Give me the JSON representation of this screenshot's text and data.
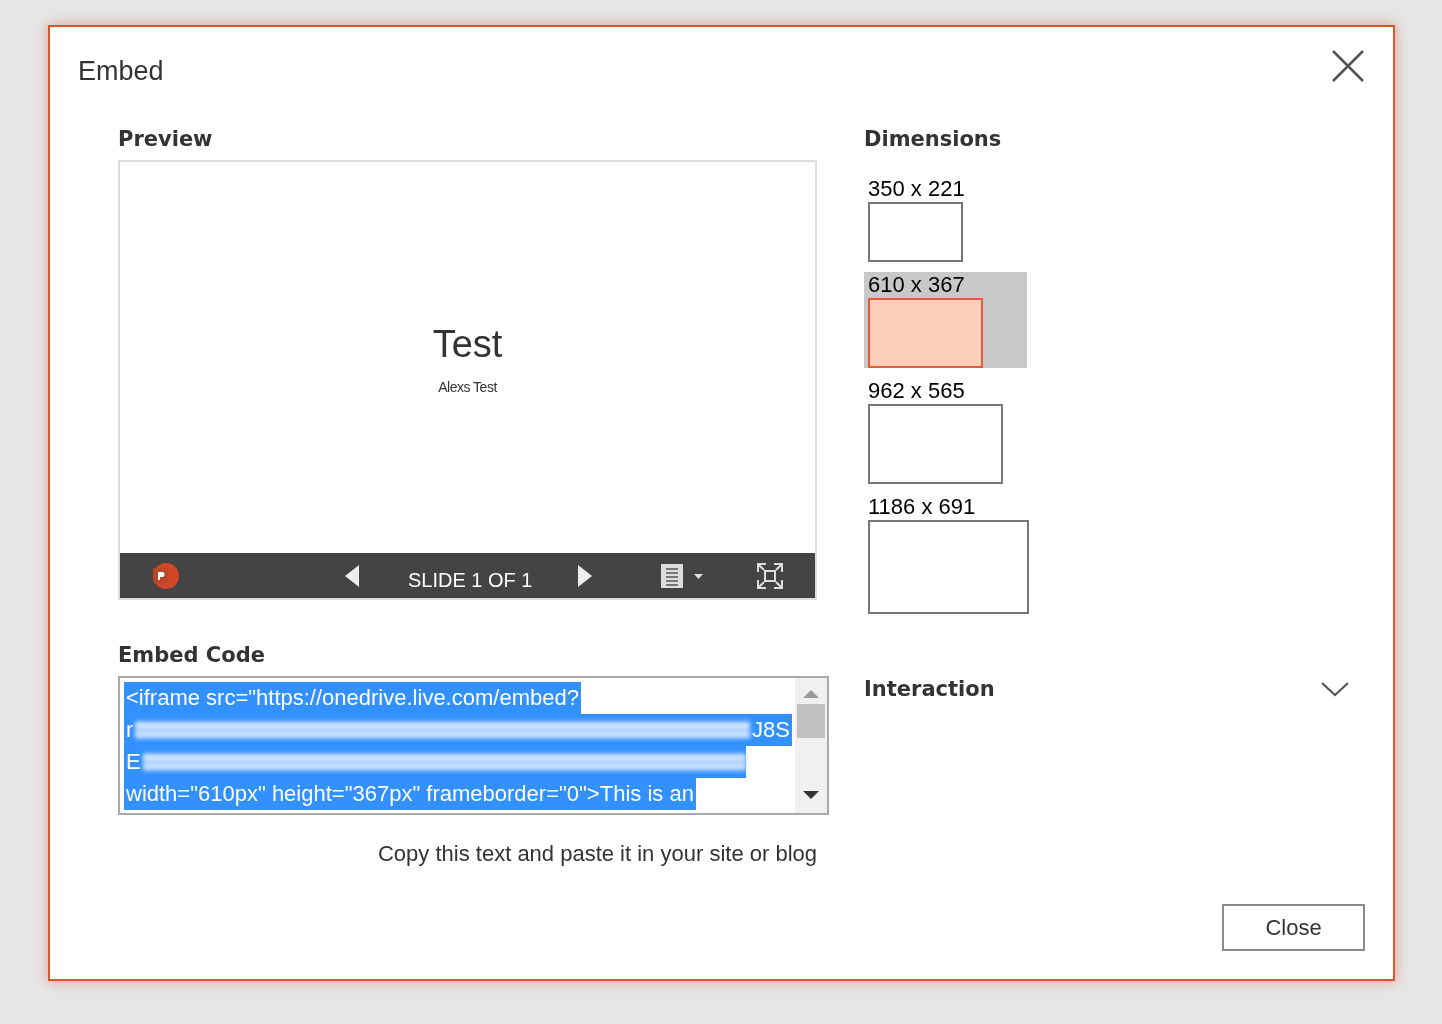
{
  "dialog": {
    "title": "Embed"
  },
  "preview": {
    "heading": "Preview",
    "slide": {
      "title": "Test",
      "subtitle": "Alexs Test"
    },
    "toolbar": {
      "counter": "SLIDE 1 OF 1"
    }
  },
  "embed_code": {
    "heading": "Embed Code",
    "lines": [
      {
        "kind": "text",
        "text": "<iframe src=\"https://onedrive.live.com/embed?"
      },
      {
        "kind": "redacted",
        "start": "r",
        "end": "J8S"
      },
      {
        "kind": "redacted",
        "start": "E"
      },
      {
        "kind": "text",
        "text": "width=\"610px\" height=\"367px\" frameborder=\"0\">This is an"
      }
    ],
    "hint": "Copy this text and paste it in your site or blog"
  },
  "dimensions": {
    "heading": "Dimensions",
    "options": [
      {
        "label": "350 x 221",
        "selected": false
      },
      {
        "label": "610 x 367",
        "selected": true
      },
      {
        "label": "962 x 565",
        "selected": false
      },
      {
        "label": "1186 x 691",
        "selected": false
      }
    ]
  },
  "interaction": {
    "heading": "Interaction",
    "expanded": false
  },
  "buttons": [
    "Close"
  ]
}
